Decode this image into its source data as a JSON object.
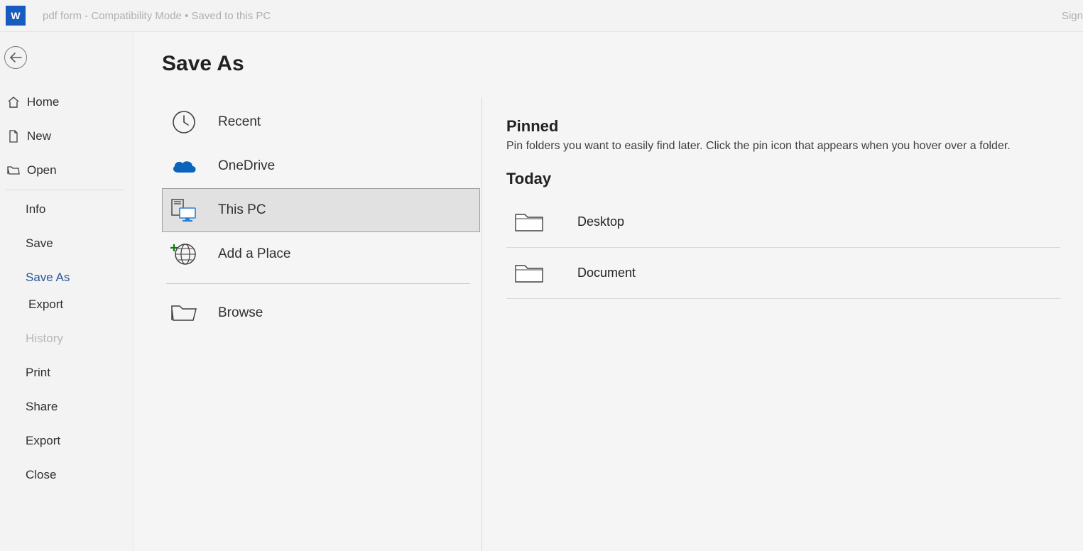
{
  "titlebar": {
    "doc_title": "pdf form  -  Compatibility Mode • Saved to this PC",
    "signin": "Sign"
  },
  "sidebar": {
    "home": "Home",
    "new": "New",
    "open": "Open",
    "info": "Info",
    "save": "Save",
    "save_as": "Save As",
    "export_quick": "Export",
    "history": "History",
    "print": "Print",
    "share": "Share",
    "export": "Export",
    "close": "Close"
  },
  "page": {
    "title": "Save As"
  },
  "locations": {
    "recent": "Recent",
    "onedrive": "OneDrive",
    "this_pc": "This PC",
    "add_place": "Add a Place",
    "browse": "Browse"
  },
  "right": {
    "pinned_title": "Pinned",
    "pinned_hint": "Pin folders you want to easily find later. Click the pin icon that appears when you hover over a folder.",
    "today_title": "Today",
    "folders": [
      {
        "label": "Desktop"
      },
      {
        "label": "Document"
      }
    ]
  }
}
